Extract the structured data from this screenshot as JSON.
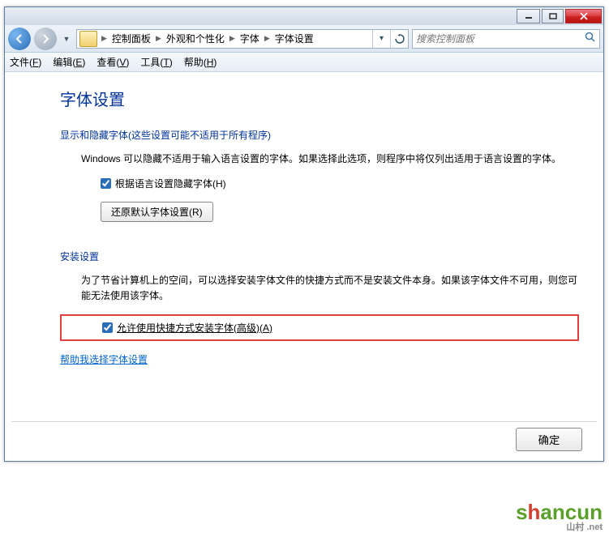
{
  "breadcrumbs": [
    "控制面板",
    "外观和个性化",
    "字体",
    "字体设置"
  ],
  "search": {
    "placeholder": "搜索控制面板"
  },
  "menu": {
    "file": "文件(F)",
    "edit": "编辑(E)",
    "view": "查看(V)",
    "tools": "工具(T)",
    "help": "帮助(H)"
  },
  "page": {
    "title": "字体设置",
    "section1_header": "显示和隐藏字体(这些设置可能不适用于所有程序)",
    "section1_body": "Windows 可以隐藏不适用于输入语言设置的字体。如果选择此选项，则程序中将仅列出适用于语言设置的字体。",
    "checkbox1_label": "根据语言设置隐藏字体(H)",
    "restore_btn": "还原默认字体设置(R)",
    "section2_header": "安装设置",
    "section2_body": "为了节省计算机上的空间，可以选择安装字体文件的快捷方式而不是安装文件本身。如果该字体文件不可用，则您可能无法使用该字体。",
    "checkbox2_label": "允许使用快捷方式安装字体(高级)(A)",
    "help_link": "帮助我选择字体设置",
    "ok_label": "确定"
  },
  "watermark": {
    "brand": "shancun",
    "domain": ".net",
    "sub": "山村"
  }
}
